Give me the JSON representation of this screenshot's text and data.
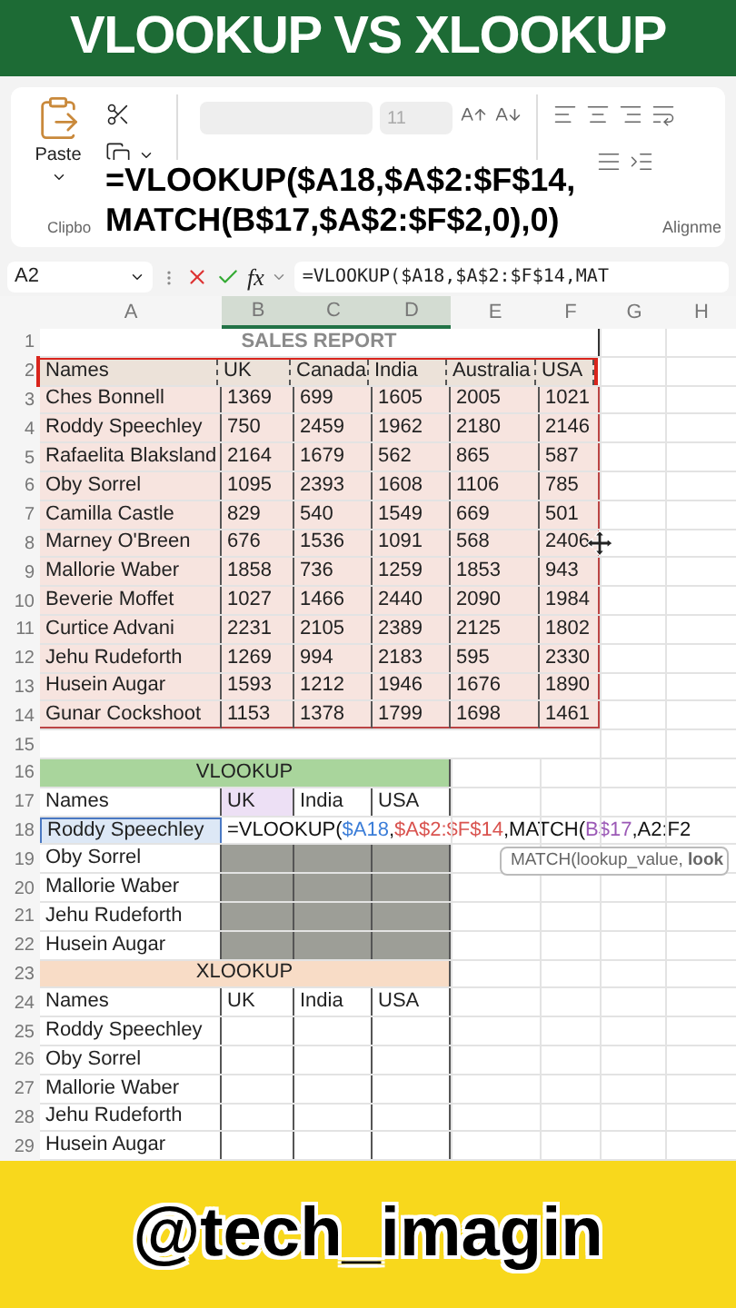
{
  "banner_title": "VLOOKUP VS XLOOKUP",
  "ribbon": {
    "paste_label": "Paste",
    "font_size": "11",
    "clipboard_group": "Clipbo",
    "alignment_group": "Alignme"
  },
  "overlay_formula": [
    "=VLOOKUP($A18,$A$2:$F$14,",
    "MATCH(B$17,$A$2:$F$2,0),0)"
  ],
  "formula_bar": {
    "name_box": "A2",
    "fx": "fx",
    "formula": "=VLOOKUP($A18,$A$2:$F$14,MAT"
  },
  "columns": [
    {
      "label": "A",
      "selected": false
    },
    {
      "label": "B",
      "selected": true
    },
    {
      "label": "C",
      "selected": true
    },
    {
      "label": "D",
      "selected": true
    },
    {
      "label": "E",
      "selected": false
    },
    {
      "label": "F",
      "selected": false
    },
    {
      "label": "G",
      "selected": false
    },
    {
      "label": "H",
      "selected": false
    }
  ],
  "row_numbers": [
    "1",
    "2",
    "3",
    "4",
    "5",
    "6",
    "7",
    "8",
    "9",
    "10",
    "11",
    "12",
    "13",
    "14",
    "15",
    "16",
    "17",
    "18",
    "19",
    "20",
    "21",
    "22",
    "23",
    "24",
    "25",
    "26",
    "27",
    "28",
    "29"
  ],
  "sales_report": {
    "title": "SALES REPORT",
    "header": [
      "Names",
      "UK",
      "Canada",
      "India",
      "Australia",
      "USA"
    ],
    "rows": [
      [
        "Ches Bonnell",
        "1369",
        "699",
        "1605",
        "2005",
        "1021"
      ],
      [
        "Roddy Speechley",
        "750",
        "2459",
        "1962",
        "2180",
        "2146"
      ],
      [
        "Rafaelita Blaksland",
        "2164",
        "1679",
        "562",
        "865",
        "587"
      ],
      [
        "Oby Sorrel",
        "1095",
        "2393",
        "1608",
        "1106",
        "785"
      ],
      [
        "Camilla Castle",
        "829",
        "540",
        "1549",
        "669",
        "501"
      ],
      [
        "Marney O'Breen",
        "676",
        "1536",
        "1091",
        "568",
        "2406"
      ],
      [
        "Mallorie Waber",
        "1858",
        "736",
        "1259",
        "1853",
        "943"
      ],
      [
        "Beverie Moffet",
        "1027",
        "1466",
        "2440",
        "2090",
        "1984"
      ],
      [
        "Curtice Advani",
        "2231",
        "2105",
        "2389",
        "2125",
        "1802"
      ],
      [
        "Jehu Rudeforth",
        "1269",
        "994",
        "2183",
        "595",
        "2330"
      ],
      [
        "Husein Augar",
        "1593",
        "1212",
        "1946",
        "1676",
        "1890"
      ],
      [
        "Gunar Cockshoot",
        "1153",
        "1378",
        "1799",
        "1698",
        "1461"
      ]
    ]
  },
  "vlookup_table": {
    "title": "VLOOKUP",
    "header": [
      "Names",
      "UK",
      "India",
      "USA"
    ],
    "names": [
      "Roddy Speechley",
      "Oby Sorrel",
      "Mallorie Waber",
      "Jehu Rudeforth",
      "Husein Augar"
    ],
    "editing_formula": [
      {
        "text": "=VLOOKUP(",
        "color": "#111111"
      },
      {
        "text": "$A18",
        "color": "#3b7dd8"
      },
      {
        "text": ",",
        "color": "#111111"
      },
      {
        "text": "$A$2:$F$14",
        "color": "#d9534f"
      },
      {
        "text": ",MATCH(",
        "color": "#111111"
      },
      {
        "text": "B$17",
        "color": "#9b59b6"
      },
      {
        "text": ",A2:F2",
        "color": "#111111"
      }
    ]
  },
  "xlookup_table": {
    "title": "XLOOKUP",
    "header": [
      "Names",
      "UK",
      "India",
      "USA"
    ],
    "names": [
      "Roddy Speechley",
      "Oby Sorrel",
      "Mallorie Waber",
      "Jehu Rudeforth",
      "Husein Augar"
    ]
  },
  "tooltip": "MATCH(lookup_value, **look**",
  "handle": "@tech_imagin"
}
